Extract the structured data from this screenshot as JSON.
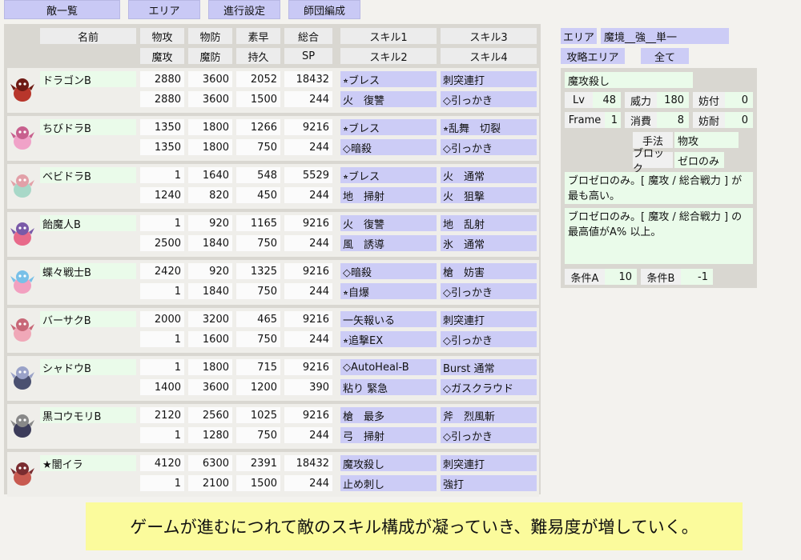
{
  "tabs": [
    "敵一覧",
    "エリア",
    "進行設定",
    "師団編成"
  ],
  "area": {
    "label": "エリア",
    "value": "魔境__強__単一",
    "filter_label": "攻略エリア",
    "filter_value": "全て"
  },
  "headers": {
    "name": "名前",
    "row1": [
      "物攻",
      "物防",
      "素早",
      "総合"
    ],
    "row2": [
      "魔攻",
      "魔防",
      "持久",
      "SP"
    ],
    "skills_row1": [
      "スキル1",
      "スキル3"
    ],
    "skills_row2": [
      "スキル2",
      "スキル4"
    ]
  },
  "enemies": [
    {
      "name": "ドラゴンB",
      "sprite": "red-dragon",
      "stats1": [
        "2880",
        "3600",
        "2052",
        "18432"
      ],
      "stats2": [
        "2880",
        "3600",
        "1500",
        "244"
      ],
      "skill1": "⭒ブレス",
      "skill3": "刺突連打",
      "skill2": "火　復讐",
      "skill4": "◇引っかき"
    },
    {
      "name": "ちびドラB",
      "sprite": "pink-dragon",
      "stats1": [
        "1350",
        "1800",
        "1266",
        "9216"
      ],
      "stats2": [
        "1350",
        "1800",
        "750",
        "244"
      ],
      "skill1": "⭒ブレス",
      "skill3": "⭒乱舞　切裂",
      "skill2": "◇暗殺",
      "skill4": "◇引っかき"
    },
    {
      "name": "ベビドラB",
      "sprite": "baby-dragon",
      "stats1": [
        "1",
        "1640",
        "548",
        "5529"
      ],
      "stats2": [
        "1240",
        "820",
        "450",
        "244"
      ],
      "skill1": "⭒ブレス",
      "skill3": "火　通常",
      "skill2": "地　掃射",
      "skill4": "火　狙撃"
    },
    {
      "name": "飴魔人B",
      "sprite": "candy-demon",
      "stats1": [
        "1",
        "920",
        "1165",
        "9216"
      ],
      "stats2": [
        "2500",
        "1840",
        "750",
        "244"
      ],
      "skill1": "火　復讐",
      "skill3": "地　乱射",
      "skill2": "風　誘導",
      "skill4": "氷　通常"
    },
    {
      "name": "蝶々戦士B",
      "sprite": "butterfly-warrior",
      "stats1": [
        "2420",
        "920",
        "1325",
        "9216"
      ],
      "stats2": [
        "1",
        "1840",
        "750",
        "244"
      ],
      "skill1": "◇暗殺",
      "skill3": "槍　妨害",
      "skill2": "⭒自爆",
      "skill4": "◇引っかき"
    },
    {
      "name": "バーサクB",
      "sprite": "berserker",
      "stats1": [
        "2000",
        "3200",
        "465",
        "9216"
      ],
      "stats2": [
        "1",
        "1600",
        "750",
        "244"
      ],
      "skill1": "一矢報いる",
      "skill3": "刺突連打",
      "skill2": "⭒追撃EX",
      "skill4": "◇引っかき"
    },
    {
      "name": "シャドウB",
      "sprite": "shadow",
      "stats1": [
        "1",
        "1800",
        "715",
        "9216"
      ],
      "stats2": [
        "1400",
        "3600",
        "1200",
        "390"
      ],
      "skill1": "◇AutoHeal-B",
      "skill3": "Burst 通常",
      "skill2": "粘り 緊急",
      "skill4": "◇ガスクラウド"
    },
    {
      "name": "黒コウモリB",
      "sprite": "black-bat",
      "stats1": [
        "2120",
        "2560",
        "1025",
        "9216"
      ],
      "stats2": [
        "1",
        "1280",
        "750",
        "244"
      ],
      "skill1": "槍　最多",
      "skill3": "斧　烈風斬",
      "skill2": "弓　掃射",
      "skill4": "◇引っかき"
    },
    {
      "name": "★闇イラ",
      "sprite": "dark-ira",
      "stats1": [
        "4120",
        "6300",
        "2391",
        "18432"
      ],
      "stats2": [
        "1",
        "2100",
        "1500",
        "244"
      ],
      "skill1": "魔攻殺し",
      "skill3": "刺突連打",
      "skill2": "止め刺し",
      "skill4": "強打"
    }
  ],
  "detail": {
    "skill_name": "魔攻殺し",
    "lv_label": "Lv",
    "lv": "48",
    "power_label": "威力",
    "power": "180",
    "guard_add_label": "妨付",
    "guard_add": "0",
    "frame_label": "Frame",
    "frame": "1",
    "cost_label": "消費",
    "cost": "8",
    "guard_res_label": "妨耐",
    "guard_res": "0",
    "method_label": "手法",
    "method": "物攻",
    "block_label": "ブロック",
    "block": "ゼロのみ",
    "desc1": "ブロゼロのみ。[ 魔攻 / 総合戦力 ] が最も高い。",
    "desc2": "ブロゼロのみ。[ 魔攻 / 総合戦力 ] の最高値がA% 以上。",
    "cond_a_label": "条件A",
    "cond_a": "10",
    "cond_b_label": "条件B",
    "cond_b": "-1"
  },
  "caption": "ゲームが進むにつれて敵のスキル構成が凝っていき、難易度が増していく。"
}
